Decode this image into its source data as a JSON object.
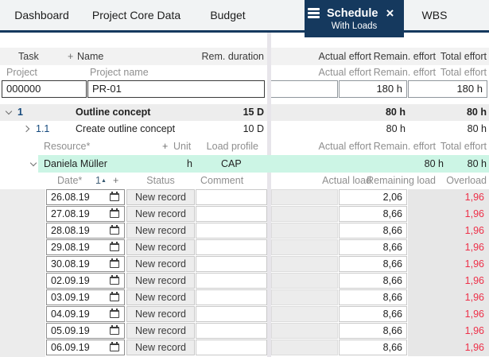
{
  "colors": {
    "navy_brand": "#15395e",
    "resource_row_teal": "#ccf5e5",
    "overload_red": "#ee2f48"
  },
  "tabs": {
    "dashboard": "Dashboard",
    "project_core_data": "Project Core Data",
    "budget": "Budget",
    "schedule": "Schedule",
    "schedule_sub": "With Loads",
    "close_icon": "×",
    "wbs": "WBS"
  },
  "task_header": {
    "task": "Task",
    "plus": "+",
    "name": "Name",
    "rem_duration": "Rem. duration",
    "actual_effort": "Actual effort",
    "remain_effort": "Remain. effort",
    "total_effort": "Total effort"
  },
  "project_header": {
    "project": "Project",
    "project_name": "Project name",
    "actual_effort": "Actual effort",
    "remain_effort": "Remain. effort",
    "total_effort": "Total effort"
  },
  "project_row": {
    "id": "000000",
    "name": "PR-01",
    "actual_effort": "",
    "remain_effort": "180 h",
    "total_effort": "180 h"
  },
  "tasks": {
    "t1": {
      "id": "1",
      "name": "Outline concept",
      "rem_duration": "15 D",
      "remain_effort": "80 h",
      "total_effort": "80 h"
    },
    "t11": {
      "id": "1.1",
      "name": "Create outline concept",
      "rem_duration": "10 D",
      "remain_effort": "80 h",
      "total_effort": "80 h"
    }
  },
  "resource_header": {
    "resource": "Resource*",
    "plus": "+",
    "unit": "Unit",
    "load_profile": "Load profile",
    "actual_effort": "Actual effort",
    "remain_effort": "Remain. effort",
    "total_effort": "Total effort"
  },
  "resource_row": {
    "name": "Daniela Müller",
    "unit": "h",
    "load_profile": "CAP",
    "remain_effort": "80 h",
    "total_effort": "80 h"
  },
  "load_header": {
    "date": "Date*",
    "sort_number": "1",
    "sort_icon": "▲",
    "plus": "+",
    "status": "Status",
    "comment": "Comment",
    "actual_load": "Actual load",
    "remaining_load": "Remaining load",
    "overload": "Overload"
  },
  "load_rows": [
    {
      "date": "26.08.19",
      "status": "New record",
      "comment": "",
      "actual_load": "",
      "remaining_load": "2,06",
      "overload": "1,96"
    },
    {
      "date": "27.08.19",
      "status": "New record",
      "comment": "",
      "actual_load": "",
      "remaining_load": "8,66",
      "overload": "1,96"
    },
    {
      "date": "28.08.19",
      "status": "New record",
      "comment": "",
      "actual_load": "",
      "remaining_load": "8,66",
      "overload": "1,96"
    },
    {
      "date": "29.08.19",
      "status": "New record",
      "comment": "",
      "actual_load": "",
      "remaining_load": "8,66",
      "overload": "1,96"
    },
    {
      "date": "30.08.19",
      "status": "New record",
      "comment": "",
      "actual_load": "",
      "remaining_load": "8,66",
      "overload": "1,96"
    },
    {
      "date": "02.09.19",
      "status": "New record",
      "comment": "",
      "actual_load": "",
      "remaining_load": "8,66",
      "overload": "1,96"
    },
    {
      "date": "03.09.19",
      "status": "New record",
      "comment": "",
      "actual_load": "",
      "remaining_load": "8,66",
      "overload": "1,96"
    },
    {
      "date": "04.09.19",
      "status": "New record",
      "comment": "",
      "actual_load": "",
      "remaining_load": "8,66",
      "overload": "1,96"
    },
    {
      "date": "05.09.19",
      "status": "New record",
      "comment": "",
      "actual_load": "",
      "remaining_load": "8,66",
      "overload": "1,96"
    },
    {
      "date": "06.09.19",
      "status": "New record",
      "comment": "",
      "actual_load": "",
      "remaining_load": "8,66",
      "overload": "1,96"
    }
  ]
}
